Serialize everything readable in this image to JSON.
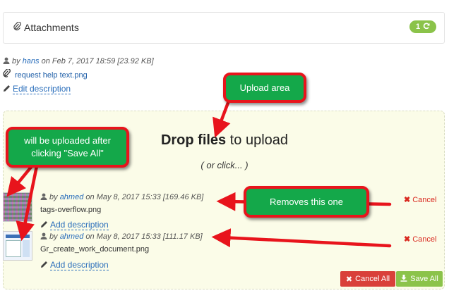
{
  "header": {
    "title": "Attachments",
    "count": "1"
  },
  "existing": {
    "by": "by",
    "user": "hans",
    "on": "on Feb 7, 2017 18:59 [23.92 KB]",
    "filename": "request help text.png",
    "edit_label": "Edit description"
  },
  "dropzone": {
    "title_bold": "Drop files",
    "title_rest": " to upload",
    "subtitle": "( or click... )"
  },
  "pending": [
    {
      "by": "by",
      "user": "ahmed",
      "on": "on May 8, 2017 15:33 [169.46 KB]",
      "filename": "tags-overflow.png",
      "add_label": "Add description",
      "cancel_label": "Cancel"
    },
    {
      "by": "by",
      "user": "ahmed",
      "on": "on May 8, 2017 15:33 [111.17 KB]",
      "filename": "Gr_create_work_document.png",
      "add_label": "Add description",
      "cancel_label": "Cancel"
    }
  ],
  "actions": {
    "cancel_all": "Cancel All",
    "save_all": "Save All"
  },
  "annotations": {
    "upload_area": "Upload area",
    "will_upload": "will be uploaded after clicking \"Save All\"",
    "removes": "Removes this one"
  },
  "colors": {
    "accent_green": "#8bc34a",
    "cancel_red": "#d9403a",
    "link_blue": "#2a6ebb",
    "callout_green": "#14a84a",
    "callout_border": "#e8141c"
  }
}
